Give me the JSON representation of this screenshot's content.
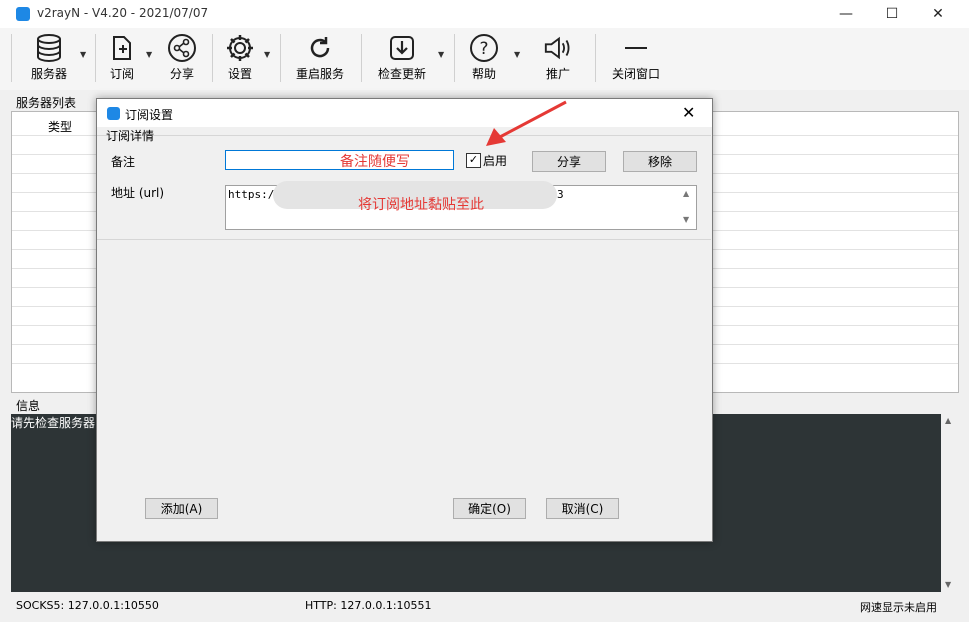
{
  "window": {
    "title": "v2rayN - V4.20 - 2021/07/07",
    "minimize": "—",
    "maximize": "☐",
    "close": "✕"
  },
  "toolbar": {
    "servers": "服务器",
    "subscribe": "订阅",
    "share": "分享",
    "settings": "设置",
    "restart": "重启服务",
    "check_update": "检查更新",
    "help": "帮助",
    "promote": "推广",
    "close_window": "关闭窗口"
  },
  "server_list": {
    "label": "服务器列表",
    "col_type": "类型"
  },
  "info": {
    "label": "信息",
    "text": "请先检查服务器"
  },
  "status": {
    "socks": "SOCKS5:  127.0.0.1:10550",
    "http": "HTTP:  127.0.0.1:10551",
    "speed": "网速显示未启用"
  },
  "dialog": {
    "title": "订阅设置",
    "group_label": "订阅详情",
    "remark_label": "备注",
    "remark_value": "",
    "remark_annotation": "备注随便写",
    "enable_label": "启用",
    "enable_checked": "✓",
    "share_btn": "分享",
    "remove_btn": "移除",
    "url_label": "地址 (url)",
    "url_start": "https:/",
    "url_end": "3",
    "url_annotation": "将订阅地址黏贴至此",
    "add_btn": "添加(A)",
    "ok_btn": "确定(O)",
    "cancel_btn": "取消(C)",
    "close": "✕"
  },
  "colors": {
    "accent": "#1e88e5",
    "annotation": "#e53935",
    "console": "#2d3436"
  }
}
